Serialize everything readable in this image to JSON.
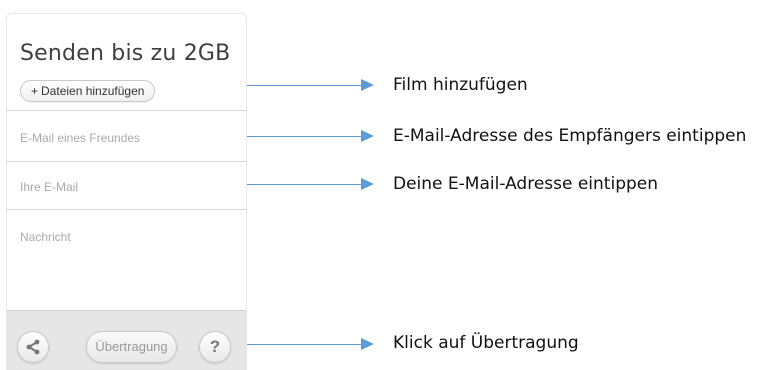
{
  "panel": {
    "title": "Senden bis zu 2GB",
    "add_files_label": "Dateien hinzufügen",
    "add_files_icon": "plus-icon",
    "friend_email_placeholder": "E-Mail eines Freundes",
    "own_email_placeholder": "Ihre E-Mail",
    "message_placeholder": "Nachricht",
    "transfer_label": "Übertragung",
    "share_icon": "share-icon",
    "help_icon": "help-icon",
    "help_glyph": "?"
  },
  "annotations": [
    {
      "text": "Film hinzufügen"
    },
    {
      "text": "E-Mail-Adresse des Empfängers eintippen"
    },
    {
      "text": "Deine E-Mail-Adresse eintippen"
    },
    {
      "text": "Klick auf Übertragung"
    }
  ],
  "colors": {
    "annotation_arrow": "#5b9bd5",
    "title_text": "#3f3f3f",
    "placeholder_text": "#aaaaaa",
    "toolbar_bg": "#e6e6e6"
  }
}
